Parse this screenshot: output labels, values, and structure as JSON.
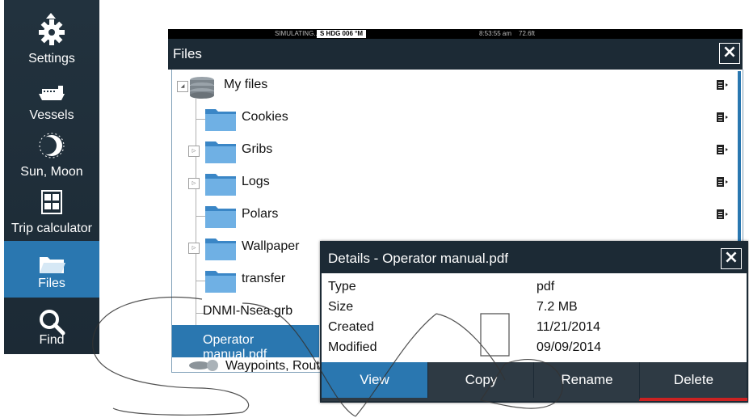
{
  "sidebar": {
    "items": [
      {
        "label": "Settings",
        "icon": "gear-icon"
      },
      {
        "label": "Vessels",
        "icon": "vessel-icon"
      },
      {
        "label": "Sun, Moon",
        "icon": "moon-icon"
      },
      {
        "label": "Trip calculator",
        "icon": "calculator-icon"
      },
      {
        "label": "Files",
        "icon": "folder-open-icon",
        "active": true
      },
      {
        "label": "Find",
        "icon": "search-icon"
      }
    ]
  },
  "status": {
    "simulating": "SIMULATING...",
    "heading": "S HDG 006 °M",
    "time": "8:53:55 am",
    "depth": "72.6ft"
  },
  "window": {
    "title": "Files"
  },
  "files": {
    "root": "My files",
    "items": [
      {
        "name": "Cookies"
      },
      {
        "name": "Gribs"
      },
      {
        "name": "Logs"
      },
      {
        "name": "Polars"
      },
      {
        "name": "Wallpaper"
      },
      {
        "name": "transfer"
      },
      {
        "name": "DNMI-Nsea.grb"
      },
      {
        "name": "Operator manual.pdf",
        "selected": true
      },
      {
        "name": "Waypoints, Routes"
      }
    ]
  },
  "details": {
    "title": "Details - Operator manual.pdf",
    "rows": [
      {
        "label": "Type",
        "value": "pdf"
      },
      {
        "label": "Size",
        "value": "7.2 MB"
      },
      {
        "label": "Created",
        "value": "11/21/2014"
      },
      {
        "label": "Modified",
        "value": "09/09/2014"
      }
    ],
    "actions": {
      "view": "View",
      "copy": "Copy",
      "rename": "Rename",
      "delete": "Delete"
    }
  },
  "colors": {
    "accent": "#2a77b0",
    "dark": "#1c2a35",
    "danger": "#cc2222"
  }
}
